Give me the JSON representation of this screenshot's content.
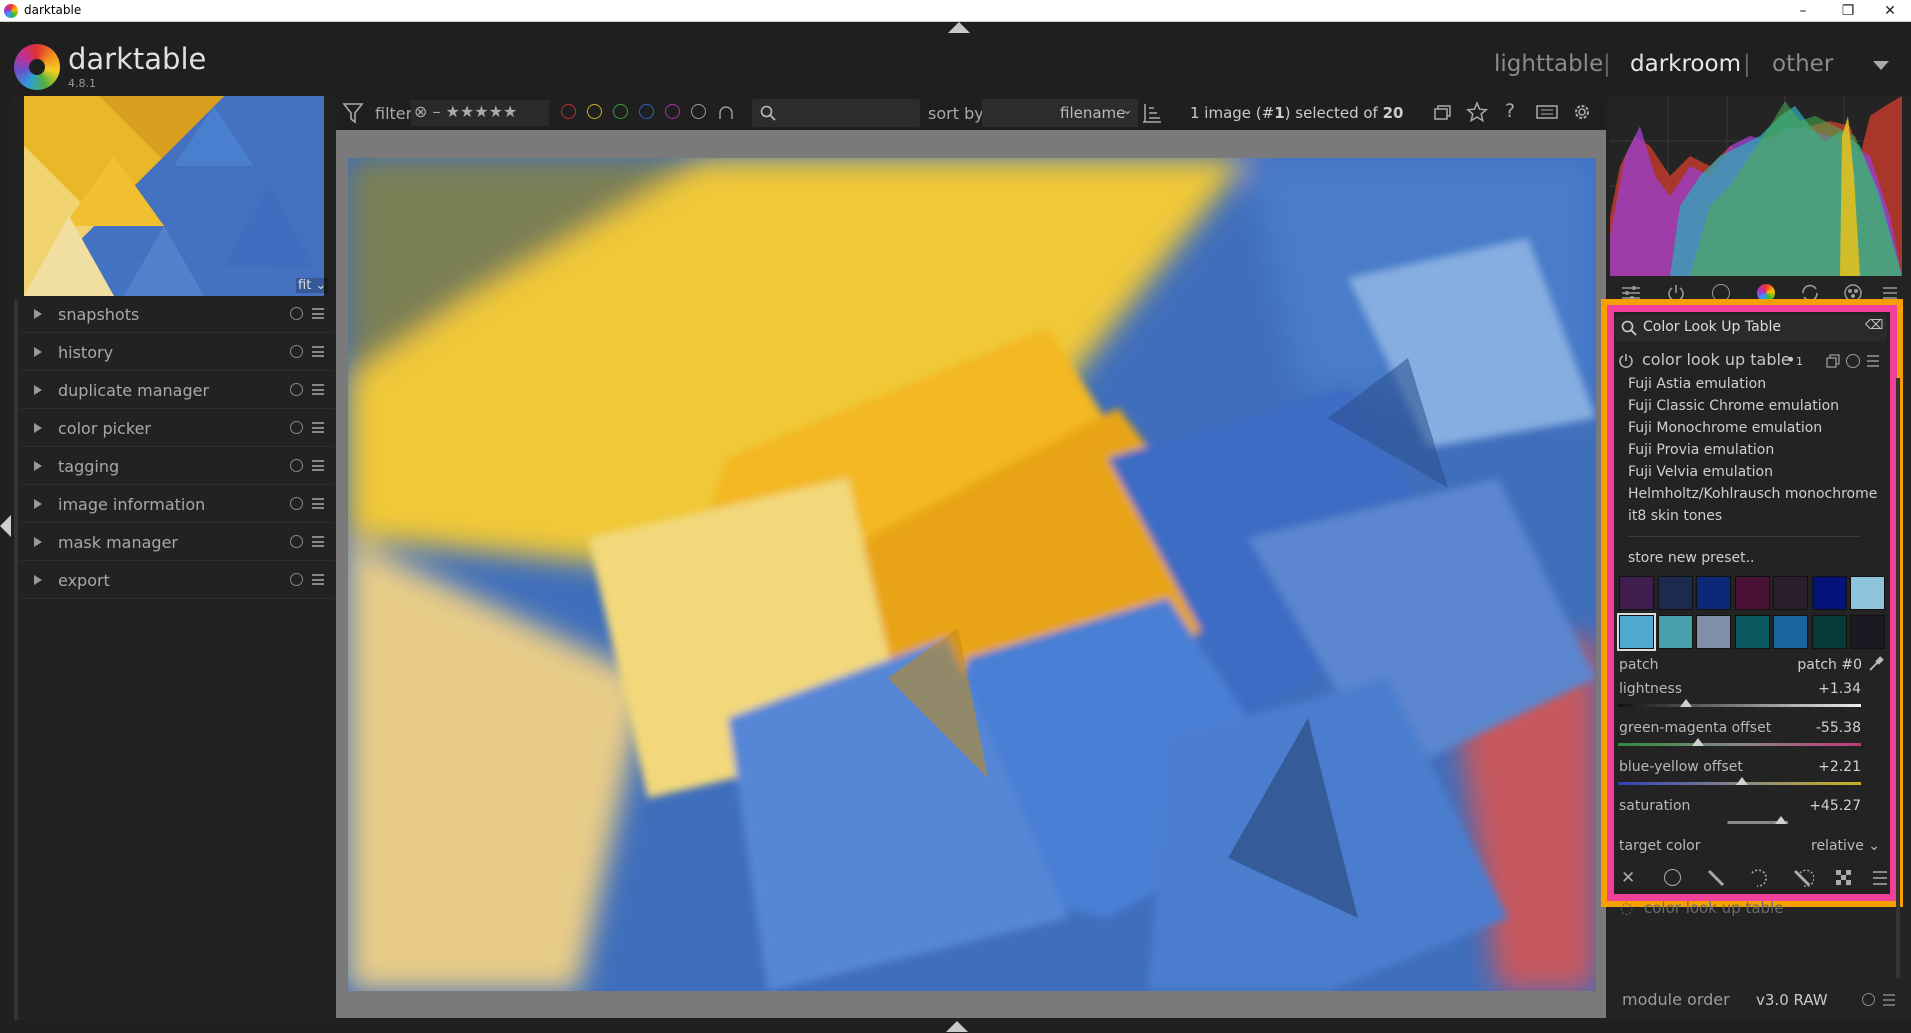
{
  "window": {
    "title": "darktable"
  },
  "app": {
    "name": "darktable",
    "version": "4.8.1"
  },
  "views": {
    "lighttable": "lighttable",
    "darkroom": "darkroom",
    "other": "other",
    "separator": "|"
  },
  "left_modules": [
    "snapshots",
    "history",
    "duplicate manager",
    "color picker",
    "tagging",
    "image information",
    "mask manager",
    "export"
  ],
  "thumbnail": {
    "zoom": "fit"
  },
  "filterbar": {
    "filter_label": "filter",
    "sort_label": "sort by",
    "sort_value": "filename",
    "selection_prefix": "1 image (#",
    "selection_num": "1",
    "selection_mid": ") selected of ",
    "selection_total": "20",
    "color_labels": [
      "#c03030",
      "#c8b020",
      "#3a9a3a",
      "#3060c0",
      "#b030b0",
      "#9a9a9a"
    ]
  },
  "right_panel": {
    "search_text": "Color Look Up Table",
    "module_title": "color look up table",
    "module_instance": "1",
    "presets": [
      "Fuji Astia emulation",
      "Fuji Classic Chrome emulation",
      "Fuji Monochrome emulation",
      "Fuji Provia emulation",
      "Fuji Velvia emulation",
      "Helmholtz/Kohlrausch monochrome",
      "it8 skin tones"
    ],
    "store_preset": "store new preset..",
    "patch_label": "patch",
    "patch_value": "patch #0",
    "sliders": [
      {
        "label": "lightness",
        "value": "+1.34",
        "position": 0.28
      },
      {
        "label": "green-magenta offset",
        "value": "-55.38",
        "position": 0.33
      },
      {
        "label": "blue-yellow offset",
        "value": "+2.21",
        "position": 0.51
      },
      {
        "label": "saturation",
        "value": "+45.27",
        "position": 0.67
      }
    ],
    "target_color_label": "target color",
    "target_color_value": "relative",
    "collapsed_module": "color look up table",
    "module_order_label": "module order",
    "module_order_value": "v3.0 RAW",
    "swatches_row1": [
      "#3f1d4e",
      "#1c2a4e",
      "#0a2a78",
      "#4a1234",
      "#2d1e2e",
      "#04127a",
      "#8ec3dc"
    ],
    "swatches_row2": [
      "#4ea8d0",
      "#4a9fae",
      "#7f90a8",
      "#0a5a60",
      "#1a64a0",
      "#063a36",
      "#1a1a22"
    ]
  },
  "accents": {
    "highlight_inner": "#f0409a",
    "highlight_outer": "#f5a000"
  }
}
